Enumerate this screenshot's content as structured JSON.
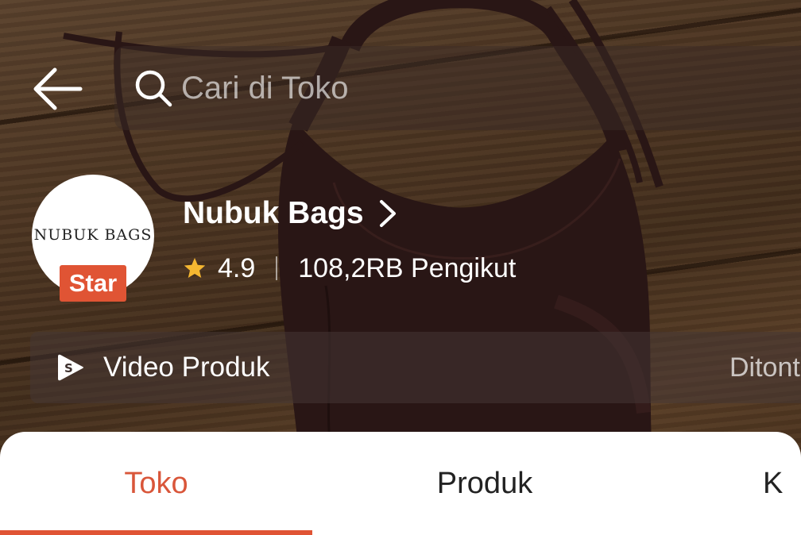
{
  "search": {
    "placeholder": "Cari di Toko"
  },
  "shop": {
    "logo_text": "NUBUK BAGS",
    "badge": "Star",
    "name": "Nubuk Bags",
    "rating": "4.9",
    "followers": "108,2RB Pengikut"
  },
  "video_bar": {
    "label": "Video Produk",
    "watched_text": "Ditonton"
  },
  "tabs": [
    {
      "label": "Toko",
      "active": true
    },
    {
      "label": "Produk",
      "active": false
    },
    {
      "label": "K",
      "active": false
    }
  ],
  "colors": {
    "accent": "#e05434",
    "active_tab_text": "#d9563a",
    "star": "#f5b731"
  }
}
